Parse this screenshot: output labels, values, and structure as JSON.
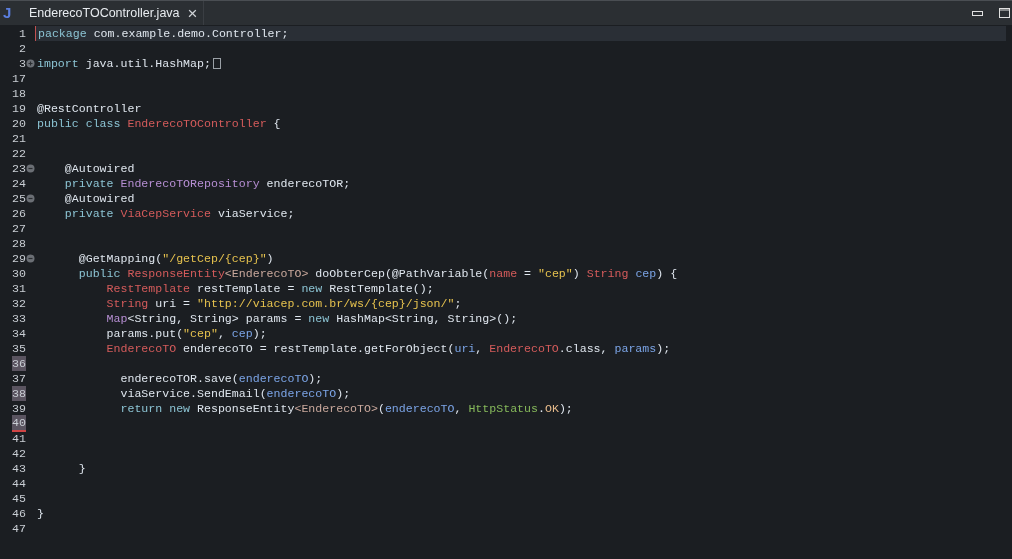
{
  "tab": {
    "icon_letter": "J",
    "title": "EnderecoTOController.java",
    "close": "×"
  },
  "lines": [
    {
      "n": "1",
      "current": true,
      "changed": false,
      "segments": [
        {
          "kind": "kw",
          "text": "package"
        },
        {
          "kind": "plain",
          "text": " com.example.demo.Controller;"
        }
      ]
    },
    {
      "n": "2",
      "current": false,
      "changed": false
    },
    {
      "n": "3",
      "current": false,
      "changed": false,
      "foldable": true,
      "collapsed": true,
      "segments": [
        {
          "kind": "kw",
          "text": "import"
        },
        {
          "kind": "plain",
          "text": " java.util.HashMap;"
        }
      ]
    },
    {
      "n": "17",
      "current": false,
      "changed": false
    },
    {
      "n": "18",
      "current": false,
      "changed": false
    },
    {
      "n": "19",
      "current": false,
      "changed": false,
      "segments": [
        {
          "kind": "plain",
          "text": "@RestController"
        }
      ]
    },
    {
      "n": "20",
      "current": false,
      "changed": false,
      "segments": [
        {
          "kind": "kw",
          "text": "public class "
        },
        {
          "kind": "type",
          "text": "EnderecoTOController"
        },
        {
          "kind": "plain",
          "text": " {"
        }
      ]
    },
    {
      "n": "21",
      "current": false,
      "changed": false
    },
    {
      "n": "22",
      "current": false,
      "changed": false
    },
    {
      "n": "23",
      "current": false,
      "changed": false,
      "foldable": true,
      "collapsed": false,
      "segments": [
        {
          "kind": "plain",
          "text": "    @Autowired"
        }
      ]
    },
    {
      "n": "24",
      "current": false,
      "changed": false,
      "segments": [
        {
          "kind": "kw",
          "text": "    private "
        },
        {
          "kind": "iface",
          "text": "EnderecoTORepository"
        },
        {
          "kind": "plain",
          "text": " enderecoTOR;"
        }
      ]
    },
    {
      "n": "25",
      "current": false,
      "changed": false,
      "foldable": true,
      "collapsed": false,
      "segments": [
        {
          "kind": "plain",
          "text": "    @Autowired"
        }
      ]
    },
    {
      "n": "26",
      "current": false,
      "changed": false,
      "segments": [
        {
          "kind": "kw",
          "text": "    private "
        },
        {
          "kind": "type",
          "text": "ViaCepService"
        },
        {
          "kind": "plain",
          "text": " viaService;"
        }
      ]
    },
    {
      "n": "27",
      "current": false,
      "changed": false
    },
    {
      "n": "28",
      "current": false,
      "changed": false
    },
    {
      "n": "29",
      "current": false,
      "changed": false,
      "foldable": true,
      "collapsed": false,
      "segments": [
        {
          "kind": "plain",
          "text": "      @GetMapping("
        },
        {
          "kind": "str",
          "text": "\"/getCep/{cep}\""
        },
        {
          "kind": "plain",
          "text": ")"
        }
      ]
    },
    {
      "n": "30",
      "current": false,
      "changed": false,
      "segments": [
        {
          "kind": "kw",
          "text": "      public "
        },
        {
          "kind": "type",
          "text": "ResponseEntity"
        },
        {
          "kind": "generic",
          "text": "<EnderecoTO>"
        },
        {
          "kind": "plain",
          "text": " doObterCep(@PathVariable("
        },
        {
          "kind": "type",
          "text": "name"
        },
        {
          "kind": "plain",
          "text": " = "
        },
        {
          "kind": "str",
          "text": "\"cep\""
        },
        {
          "kind": "plain",
          "text": ") "
        },
        {
          "kind": "type",
          "text": "String"
        },
        {
          "kind": "var",
          "text": " cep"
        },
        {
          "kind": "plain",
          "text": ") {"
        }
      ]
    },
    {
      "n": "31",
      "current": false,
      "changed": false,
      "segments": [
        {
          "kind": "type",
          "text": "          RestTemplate"
        },
        {
          "kind": "plain",
          "text": " restTemplate = "
        },
        {
          "kind": "kw",
          "text": "new"
        },
        {
          "kind": "plain",
          "text": " RestTemplate();"
        }
      ]
    },
    {
      "n": "32",
      "current": false,
      "changed": false,
      "segments": [
        {
          "kind": "type",
          "text": "          String"
        },
        {
          "kind": "plain",
          "text": " uri = "
        },
        {
          "kind": "str",
          "text": "\"http://viacep.com.br/ws/{cep}/json/\""
        },
        {
          "kind": "plain",
          "text": ";"
        }
      ]
    },
    {
      "n": "33",
      "current": false,
      "changed": false,
      "segments": [
        {
          "kind": "iface",
          "text": "          Map"
        },
        {
          "kind": "plain",
          "text": "<String, String> params = "
        },
        {
          "kind": "kw",
          "text": "new"
        },
        {
          "kind": "plain",
          "text": " HashMap<String, String>();"
        }
      ]
    },
    {
      "n": "34",
      "current": false,
      "changed": false,
      "segments": [
        {
          "kind": "plain",
          "text": "          params.put("
        },
        {
          "kind": "str",
          "text": "\"cep\""
        },
        {
          "kind": "plain",
          "text": ", "
        },
        {
          "kind": "var",
          "text": "cep"
        },
        {
          "kind": "plain",
          "text": ");"
        }
      ]
    },
    {
      "n": "35",
      "current": false,
      "changed": false,
      "segments": [
        {
          "kind": "type",
          "text": "          EnderecoTO"
        },
        {
          "kind": "plain",
          "text": " enderecoTO = restTemplate.getForObject("
        },
        {
          "kind": "var",
          "text": "uri"
        },
        {
          "kind": "plain",
          "text": ", "
        },
        {
          "kind": "type",
          "text": "EnderecoTO"
        },
        {
          "kind": "plain",
          "text": ".class, "
        },
        {
          "kind": "var",
          "text": "params"
        },
        {
          "kind": "plain",
          "text": ");"
        }
      ]
    },
    {
      "n": "36",
      "current": false,
      "changed": true
    },
    {
      "n": "37",
      "current": false,
      "changed": false,
      "segments": [
        {
          "kind": "plain",
          "text": "            enderecoTOR.save("
        },
        {
          "kind": "var",
          "text": "enderecoTO"
        },
        {
          "kind": "plain",
          "text": ");"
        }
      ]
    },
    {
      "n": "38",
      "current": false,
      "changed": true,
      "segments": [
        {
          "kind": "plain",
          "text": "            viaService.SendEmail("
        },
        {
          "kind": "var",
          "text": "enderecoTO"
        },
        {
          "kind": "plain",
          "text": ");"
        }
      ]
    },
    {
      "n": "39",
      "current": false,
      "changed": false,
      "segments": [
        {
          "kind": "kw",
          "text": "            return new"
        },
        {
          "kind": "plain",
          "text": " ResponseEntity"
        },
        {
          "kind": "generic",
          "text": "<EnderecoTO>"
        },
        {
          "kind": "plain",
          "text": "("
        },
        {
          "kind": "var",
          "text": "enderecoTO"
        },
        {
          "kind": "plain",
          "text": ", "
        },
        {
          "kind": "enum",
          "text": "HttpStatus"
        },
        {
          "kind": "plain",
          "text": "."
        },
        {
          "kind": "const",
          "text": "OK"
        },
        {
          "kind": "plain",
          "text": ");"
        }
      ]
    },
    {
      "n": "40",
      "current": false,
      "changed": true
    },
    {
      "n": "41",
      "current": false,
      "changed": false
    },
    {
      "n": "42",
      "current": false,
      "changed": false
    },
    {
      "n": "43",
      "current": false,
      "changed": false,
      "segments": [
        {
          "kind": "plain",
          "text": "      }"
        }
      ]
    },
    {
      "n": "44",
      "current": false,
      "changed": false
    },
    {
      "n": "45",
      "current": false,
      "changed": false
    },
    {
      "n": "46",
      "current": false,
      "changed": false,
      "segments": [
        {
          "kind": "plain",
          "text": "}"
        }
      ]
    },
    {
      "n": "47",
      "current": false,
      "changed": false
    }
  ]
}
